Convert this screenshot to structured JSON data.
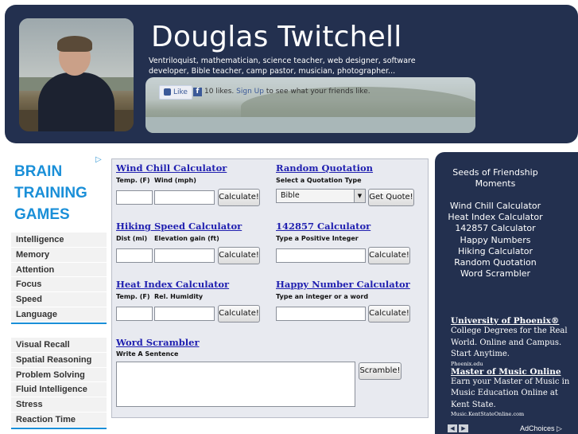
{
  "header": {
    "name": "Douglas Twitchell",
    "tagline": "Ventriloquist, mathematician, science teacher, web designer, software developer, Bible teacher, camp pastor, musician, photographer...",
    "facebook": {
      "like_label": "Like",
      "likes_text": "10 likes.",
      "signup_label": "Sign Up",
      "suffix_text": "to see what your friends like."
    }
  },
  "left_ad": {
    "title": "BRAIN TRAINING GAMES",
    "group1": [
      "Intelligence",
      "Memory",
      "Attention",
      "Focus",
      "Speed",
      "Language"
    ],
    "group2": [
      "Visual Recall",
      "Spatial Reasoning",
      "Problem Solving",
      "Fluid Intelligence",
      "Stress",
      "Reaction Time"
    ]
  },
  "calculators": {
    "wind_chill": {
      "title": "Wind Chill Calculator",
      "label1": "Temp. (F)",
      "label2": "Wind (mph)",
      "button": "Calculate!"
    },
    "random_quotation": {
      "title": "Random Quotation",
      "label": "Select a Quotation Type",
      "selected": "Bible",
      "button": "Get Quote!"
    },
    "hiking_speed": {
      "title": "Hiking Speed Calculator",
      "label1": "Dist (mi)",
      "label2": "Elevation gain (ft)",
      "button": "Calculate!"
    },
    "n142857": {
      "title": "142857 Calculator",
      "label": "Type a Positive Integer",
      "button": "Calculate!"
    },
    "heat_index": {
      "title": "Heat Index Calculator",
      "label1": "Temp. (F)",
      "label2": "Rel. Humidity",
      "button": "Calculate!"
    },
    "happy_number": {
      "title": "Happy Number Calculator",
      "label": "Type an integer or a word",
      "button": "Calculate!"
    },
    "word_scrambler": {
      "title": "Word Scrambler",
      "label": "Write A Sentence",
      "button": "Scramble!"
    }
  },
  "sidebar": {
    "seeds": "Seeds of Friendship Moments",
    "links": [
      "Wind Chill Calculator",
      "Heat Index Calculator",
      "142857 Calculator",
      "Happy Numbers",
      "Hiking Calculator",
      "Random Quotation",
      "Word Scrambler"
    ],
    "ads": [
      {
        "title": "University of Phoenix®",
        "body": "College Degrees for the Real World. Online and Campus. Start Anytime.",
        "url": "Phoenix.edu"
      },
      {
        "title": "Master of Music Online",
        "body": "Earn your Master of Music in Music Education Online at Kent State.",
        "url": "Music.KentStateOnline.com"
      }
    ],
    "adchoices": "AdChoices",
    "prev_icon": "chevron-left-icon",
    "next_icon": "chevron-right-icon"
  }
}
